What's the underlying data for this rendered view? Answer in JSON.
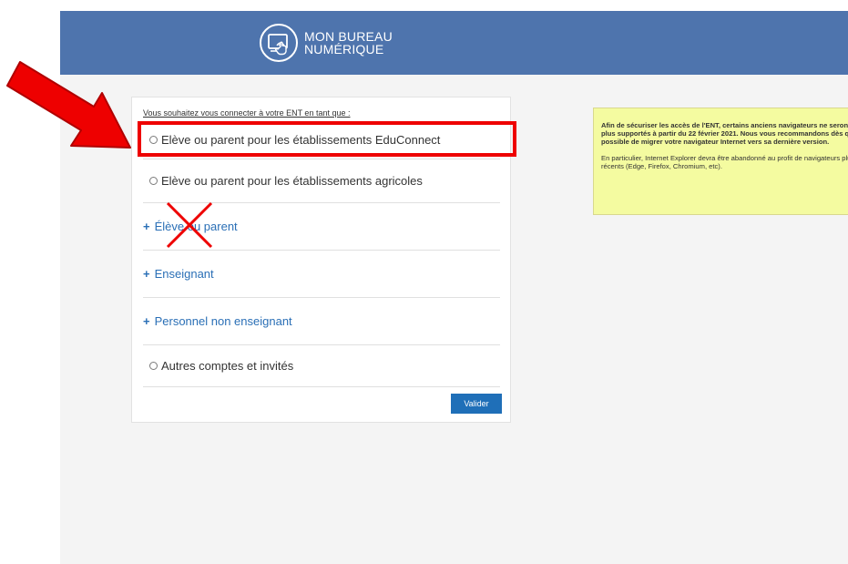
{
  "header": {
    "logo_line1": "MON BUREAU",
    "logo_line2": "NUMÉRIQUE",
    "background": "#4e74ad"
  },
  "login": {
    "prompt": "Vous souhaitez vous connecter à votre ENT en tant que :",
    "options": [
      {
        "type": "radio",
        "label": "Elève ou parent pour les établissements EduConnect",
        "highlighted": true
      },
      {
        "type": "radio",
        "label": "Elève ou parent pour les établissements agricoles"
      },
      {
        "type": "expand",
        "label": "Élève ou parent",
        "crossed_out": true
      },
      {
        "type": "expand",
        "label": "Enseignant"
      },
      {
        "type": "expand",
        "label": "Personnel non enseignant"
      },
      {
        "type": "radio",
        "label": "Autres comptes et invités"
      }
    ],
    "expand_symbol": "+",
    "submit_label": "Valider"
  },
  "notice": {
    "bold_text": "Afin de sécuriser les accès de l'ENT, certains anciens navigateurs ne seront plus supportés à partir du 22 février 2021. Nous vous recommandons dès que possible de migrer votre navigateur Internet vers sa dernière version.",
    "normal_text": "En particulier, Internet Explorer devra être abandonné au profit de navigateurs plus récents (Edge, Firefox, Chromium, etc).",
    "background": "#f4fba0"
  },
  "annotations": {
    "color": "#ee0000",
    "arrow_icon": "red-arrow-icon",
    "cross_icon": "red-cross-icon"
  }
}
